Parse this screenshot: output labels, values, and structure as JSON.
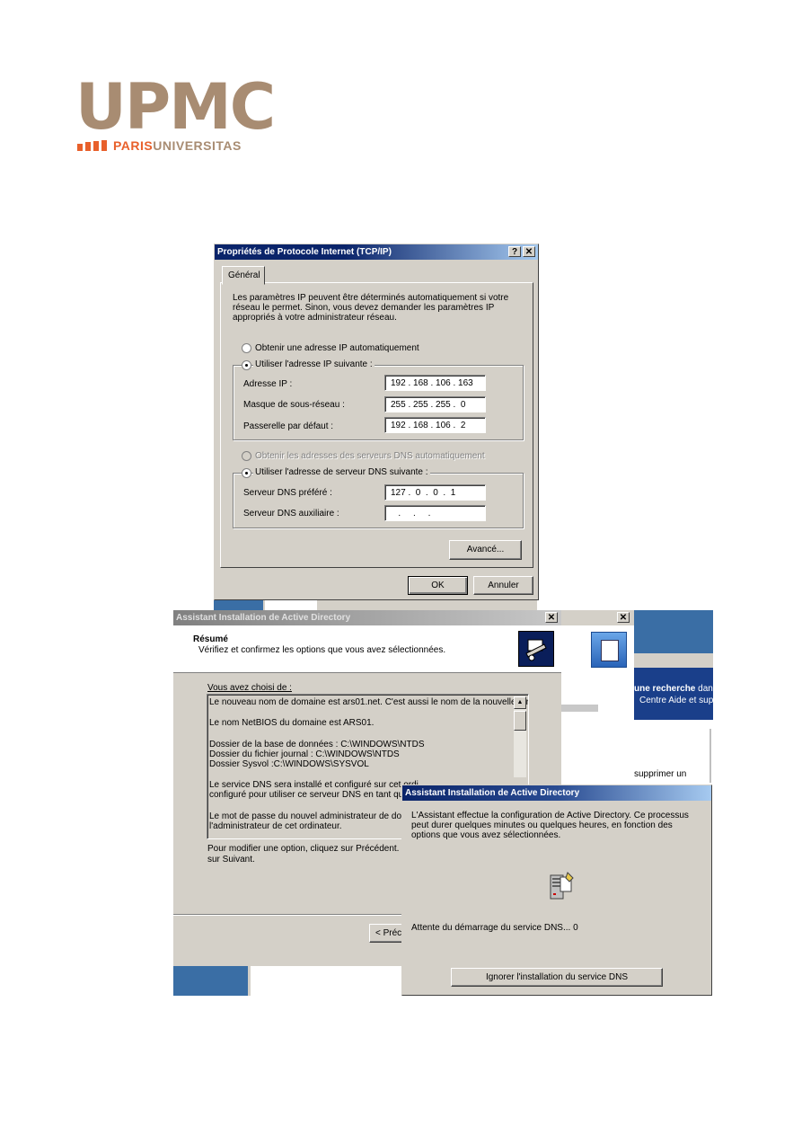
{
  "logo": {
    "letters": "UPMC",
    "paris": "PARIS",
    "universitas": "UNIVERSITAS"
  },
  "tcpip": {
    "title": "Propriétés de Protocole Internet (TCP/IP)",
    "help_btn": "?",
    "close_btn": "✕",
    "tab": "Général",
    "intro": "Les paramètres IP peuvent être déterminés automatiquement si votre réseau le permet. Sinon, vous devez demander les paramètres IP appropriés à votre administrateur réseau.",
    "radio_auto_ip": "Obtenir une adresse IP automatiquement",
    "radio_static_ip": "Utiliser l'adresse IP suivante :",
    "ip_label": "Adresse IP :",
    "ip_value": "192 . 168 . 106 . 163",
    "mask_label": "Masque de sous-réseau :",
    "mask_value": "255 . 255 . 255 .  0",
    "gw_label": "Passerelle par défaut :",
    "gw_value": "192 . 168 . 106 .  2",
    "radio_auto_dns": "Obtenir les adresses des serveurs DNS automatiquement",
    "radio_static_dns": "Utiliser l'adresse de serveur DNS suivante :",
    "dns1_label": "Serveur DNS préféré :",
    "dns1_value": "127 .  0  .  0  .  1",
    "dns2_label": "Serveur DNS auxiliaire :",
    "dns2_value": "   .     .     .   ",
    "advanced_btn": "Avancé...",
    "ok_btn": "OK",
    "cancel_btn": "Annuler"
  },
  "ad_wizard": {
    "title": "Assistant Installation de Active Directory",
    "close_btn": "✕",
    "header_title": "Résumé",
    "header_sub": "Vérifiez et confirmez les options que vous avez sélectionnées.",
    "choice_label": "Vous avez choisi de :",
    "summary_lines": [
      "Le nouveau nom de domaine est ars01.net. C'est aussi le nom de la nouvelle forêt.",
      "Le nom NetBIOS du domaine est ARS01.",
      "Dossier de la base de données : C:\\WINDOWS\\NTDS",
      "Dossier du fichier journal : C:\\WINDOWS\\NTDS",
      "Dossier Sysvol :C:\\WINDOWS\\SYSVOL",
      "Le service DNS sera installé et configuré sur cet ordi",
      "configuré pour utiliser ce serveur DNS en tant que se",
      "Le mot de passe du nouvel administrateur de domain",
      "l'administrateur de cet ordinateur."
    ],
    "footer_text_1": "Pour modifier une option, cliquez sur Précédent. Pour",
    "footer_text_2": "sur Suivant.",
    "prev_btn": "< Préc"
  },
  "bg_window": {
    "close_btn": "✕",
    "link_1": "une recherche",
    "link_1_tail": "dan",
    "link_2": "Centre Aide et supp",
    "item": "supprimer un"
  },
  "progress": {
    "title": "Assistant Installation de Active Directory",
    "message": "L'Assistant effectue la configuration de Active Directory. Ce processus peut durer quelques minutes ou quelques heures, en fonction des options que vous avez sélectionnées.",
    "status": "Attente du démarrage du service DNS... 0",
    "skip_btn": "Ignorer l'installation du service DNS"
  },
  "colors": {
    "logo_brown": "#a88c72",
    "logo_orange": "#e8602b",
    "titlebar": "#0a246a",
    "xp_blue": "#3a6ea5"
  }
}
